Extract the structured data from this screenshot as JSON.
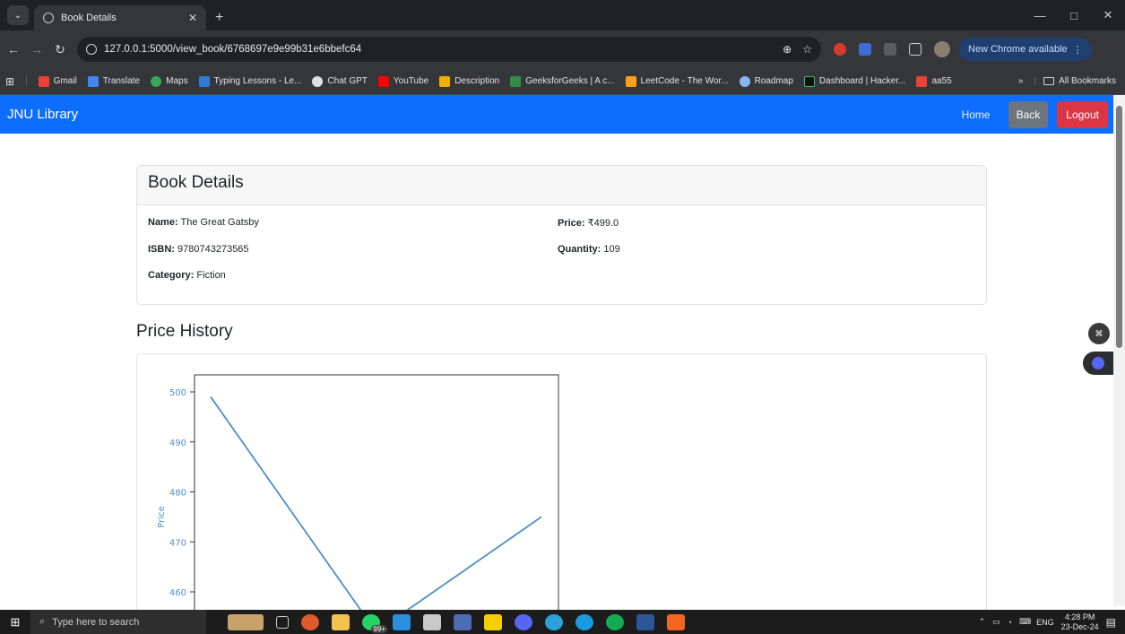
{
  "browser": {
    "tab_title": "Book Details",
    "tab_close": "✕",
    "new_tab": "+",
    "url": "127.0.0.1:5000/view_book/6768697e9e99b31e6bbefc64",
    "update_label": "New Chrome available",
    "bookmarks": [
      "Gmail",
      "Translate",
      "Maps",
      "Typing Lessons - Le...",
      "Chat GPT",
      "YouTube",
      "Description",
      "GeeksforGeeks | A c...",
      "LeetCode - The Wor...",
      "Roadmap",
      "Dashboard | Hacker...",
      "aa55"
    ],
    "all_bookmarks": "All Bookmarks",
    "overflow": "»"
  },
  "navbar": {
    "brand": "JNU Library",
    "home": "Home",
    "back": "Back",
    "logout": "Logout",
    "color": "#0d6efd"
  },
  "book": {
    "card_title": "Book Details",
    "name_label": "Name:",
    "name": "The Great Gatsby",
    "isbn_label": "ISBN:",
    "isbn": "9780743273565",
    "category_label": "Category:",
    "category": "Fiction",
    "price_label": "Price:",
    "price": "₹499.0",
    "quantity_label": "Quantity:",
    "quantity": "109"
  },
  "price_history": {
    "heading": "Price History"
  },
  "chart_data": {
    "type": "line",
    "ylabel": "Price",
    "xlabel": "",
    "yticks": [
      500,
      490,
      480,
      470,
      460
    ],
    "x": [
      0,
      1,
      2
    ],
    "series": [
      {
        "values": [
          499,
          452,
          475
        ]
      }
    ],
    "color": "#4c8fc8"
  },
  "taskbar": {
    "search_placeholder": "Type here to search",
    "lang": "ENG",
    "time": "4:28 PM",
    "date": "23-Dec-24",
    "badge": "99+"
  }
}
